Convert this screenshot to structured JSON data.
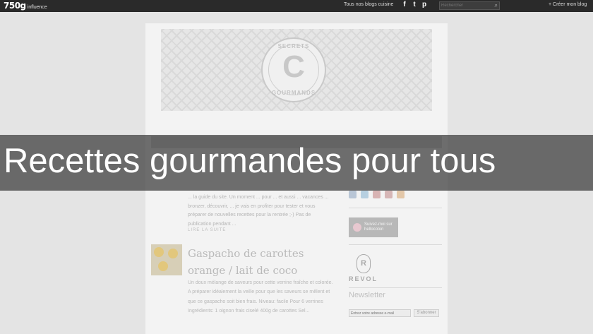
{
  "topbar": {
    "logo": "750g",
    "logo_sub": "influence",
    "blogs_link": "Tous nos blogs cuisine",
    "social_icons": [
      "facebook-icon",
      "twitter-icon",
      "pinterest-icon"
    ],
    "search_placeholder": "Rechercher",
    "create_link": "+ Créer mon blog"
  },
  "banner": {
    "badge_top": "SECRETS",
    "badge_letter": "C",
    "badge_bottom": "GOURMANDS"
  },
  "overlay_title": "Recettes gourmandes pour tous",
  "posts": [
    {
      "excerpt": "... la guide du site. Un moment ... pour ... et aussi ... vacances ... bronzer, découvrir, ... je vais en profiter pour tester et vous préparer de nouvelles recettes pour la rentrée ;-) Pas de publication pendant ...",
      "more": "LIRE LA SUITE"
    },
    {
      "title": "Gaspacho de carottes orange / lait de coco",
      "excerpt": "Un doux mélange de saveurs pour cette verrine fraîche et colorée. A préparer idéalement la veille pour que les saveurs se mêlent et que ce gaspacho soit bien frais. Niveau: facile Pour 6 verrines Ingrédients: 1 oignon frais ciselé 400g de carottes Sel..."
    }
  ],
  "sidebar": {
    "follow_label": "Suivez-moi sur hellocoton",
    "brand": "REVOL",
    "brand_letter": "R",
    "newsletter_title": "Newsletter",
    "newsletter_placeholder": "Entrez votre adresse e-mail",
    "subscribe": "S'abonner"
  }
}
